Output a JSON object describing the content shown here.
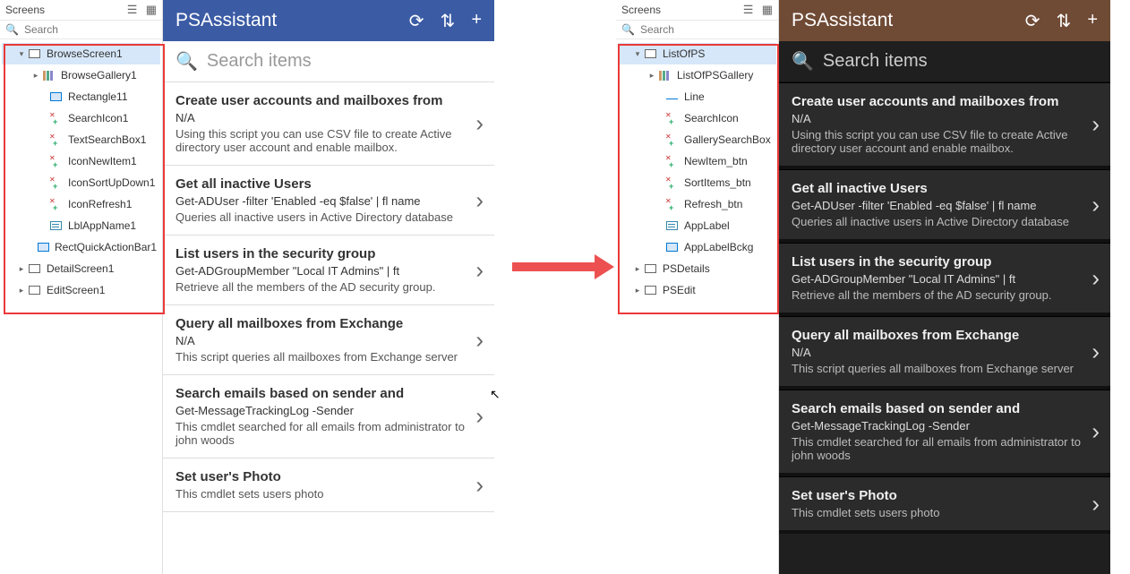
{
  "tree": {
    "header": "Screens",
    "search_placeholder": "Search"
  },
  "left_tree": {
    "items": [
      {
        "label": "BrowseScreen1",
        "icon": "screen",
        "indent": 1,
        "arrow": "▾",
        "selected": true
      },
      {
        "label": "BrowseGallery1",
        "icon": "gallery",
        "indent": 2,
        "arrow": "▸"
      },
      {
        "label": "Rectangle11",
        "icon": "rect",
        "indent": 3
      },
      {
        "label": "SearchIcon1",
        "icon": "ctrl",
        "indent": 3
      },
      {
        "label": "TextSearchBox1",
        "icon": "ctrl",
        "indent": 3
      },
      {
        "label": "IconNewItem1",
        "icon": "ctrl",
        "indent": 3
      },
      {
        "label": "IconSortUpDown1",
        "icon": "ctrl",
        "indent": 3
      },
      {
        "label": "IconRefresh1",
        "icon": "ctrl",
        "indent": 3
      },
      {
        "label": "LblAppName1",
        "icon": "label",
        "indent": 3
      },
      {
        "label": "RectQuickActionBar1",
        "icon": "rect",
        "indent": 3
      },
      {
        "label": "DetailScreen1",
        "icon": "screen",
        "indent": 1,
        "arrow": "▸"
      },
      {
        "label": "EditScreen1",
        "icon": "screen",
        "indent": 1,
        "arrow": "▸"
      }
    ]
  },
  "right_tree": {
    "items": [
      {
        "label": "ListOfPS",
        "icon": "screen",
        "indent": 1,
        "arrow": "▾",
        "selected": true
      },
      {
        "label": "ListOfPSGallery",
        "icon": "gallery",
        "indent": 2,
        "arrow": "▸"
      },
      {
        "label": "Line",
        "icon": "line",
        "indent": 3
      },
      {
        "label": "SearchIcon",
        "icon": "ctrl",
        "indent": 3
      },
      {
        "label": "GallerySearchBox",
        "icon": "ctrl",
        "indent": 3
      },
      {
        "label": "NewItem_btn",
        "icon": "ctrl",
        "indent": 3
      },
      {
        "label": "SortItems_btn",
        "icon": "ctrl",
        "indent": 3
      },
      {
        "label": "Refresh_btn",
        "icon": "ctrl",
        "indent": 3
      },
      {
        "label": "AppLabel",
        "icon": "label",
        "indent": 3
      },
      {
        "label": "AppLabelBckg",
        "icon": "rect",
        "indent": 3
      },
      {
        "label": "PSDetails",
        "icon": "screen",
        "indent": 1,
        "arrow": "▸"
      },
      {
        "label": "PSEdit",
        "icon": "screen",
        "indent": 1,
        "arrow": "▸"
      }
    ]
  },
  "app": {
    "title": "PSAssistant",
    "search_placeholder": "Search items",
    "items": [
      {
        "title": "Create user accounts and mailboxes from",
        "sub": "N/A",
        "desc": "Using this script you can use CSV file to create Active directory user account and enable mailbox."
      },
      {
        "title": "Get all inactive Users",
        "sub": "Get-ADUser -filter 'Enabled -eq $false' | fl name",
        "desc": "Queries all inactive users in Active Directory database"
      },
      {
        "title": "List users in  the security group",
        "sub": "Get-ADGroupMember \"Local IT Admins\" | ft",
        "desc": "Retrieve all the members of the AD security group."
      },
      {
        "title": "Query all mailboxes from Exchange",
        "sub": "N/A",
        "desc": "This script queries all mailboxes from Exchange server"
      },
      {
        "title": "Search emails based on sender and",
        "sub": "Get-MessageTrackingLog -Sender",
        "desc": "This cmdlet searched for all emails from administrator to john woods"
      },
      {
        "title": "Set user's Photo",
        "sub": "",
        "desc": "This cmdlet sets users photo"
      }
    ]
  }
}
